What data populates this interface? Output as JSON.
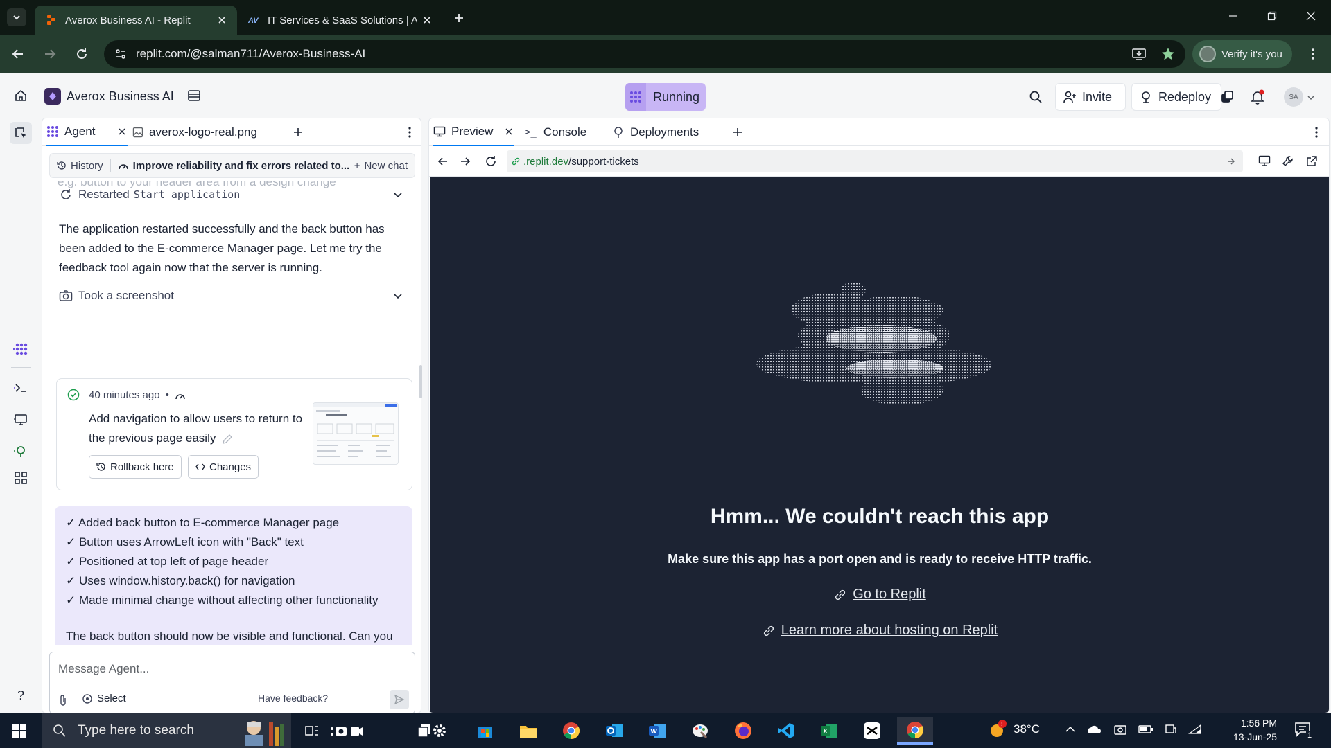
{
  "browser": {
    "tabs": [
      {
        "title": "Averox Business AI - Replit",
        "active": true
      },
      {
        "title": "IT Services & SaaS Solutions | A",
        "active": false
      }
    ],
    "url_host": "replit.com",
    "url_path": "/@salman711/Averox-Business-AI",
    "verify_label": "Verify it's you"
  },
  "replit": {
    "app_name": "Averox Business AI",
    "run_status": "Running",
    "invite_label": "Invite",
    "redeploy_label": "Redeploy",
    "avatar_initials": "SA"
  },
  "agent_panel": {
    "tabs": [
      {
        "label": "Agent"
      },
      {
        "label": "averox-logo-real.png"
      }
    ],
    "history_label": "History",
    "thread_title": "Improve reliability and fix errors related to...",
    "new_chat_label": "New chat",
    "cut_text": "e.g. button to your header area from a design change",
    "restarted_label": "Restarted",
    "restarted_cmd": "Start application",
    "message_1": "The application restarted successfully and the back button has been added to the E-commerce Manager page. Let me try the feedback tool again now that the server is running.",
    "screenshot_label": "Took a screenshot",
    "checkpoint": {
      "time": "40 minutes ago",
      "description": "Add navigation to allow users to return to the previous page easily",
      "rollback_label": "Rollback here",
      "changes_label": "Changes"
    },
    "summary_items": [
      "✓ Added back button to E-commerce Manager page",
      "✓ Button uses ArrowLeft icon with \"Back\" text",
      "✓ Positioned at top left of page header",
      "✓ Uses window.history.back() for navigation",
      "✓ Made minimal change without affecting other functionality"
    ],
    "summary_followup": "The back button should now be visible and functional. Can you test clicking it to verify it navigates to the previous page?",
    "composer_placeholder": "Message Agent...",
    "select_label": "Select",
    "feedback_label": "Have feedback?"
  },
  "preview_panel": {
    "tabs": [
      {
        "label": "Preview"
      },
      {
        "label": "Console"
      },
      {
        "label": "Deployments"
      }
    ],
    "url_host": ".replit.dev",
    "url_path": "/support-tickets",
    "error_title": "Hmm... We couldn't reach this app",
    "error_subtitle": "Make sure this app has a port open and is ready to receive HTTP traffic.",
    "link_1": "Go to Replit",
    "link_2": "Learn more about hosting on Replit"
  },
  "taskbar": {
    "search_placeholder": "Type here to search",
    "weather_temp": "38°C",
    "time": "1:56 PM",
    "date": "13-Jun-25",
    "notification_count": "1"
  },
  "colors": {
    "chrome_bg": "#0f1914",
    "chrome_active": "#253d2f",
    "replit_accent": "#0079f2",
    "running_bg": "#c8b6f5",
    "summary_bg": "#ebe8fb",
    "preview_stage": "#1c2333",
    "taskbar_bg": "#101b2b"
  }
}
